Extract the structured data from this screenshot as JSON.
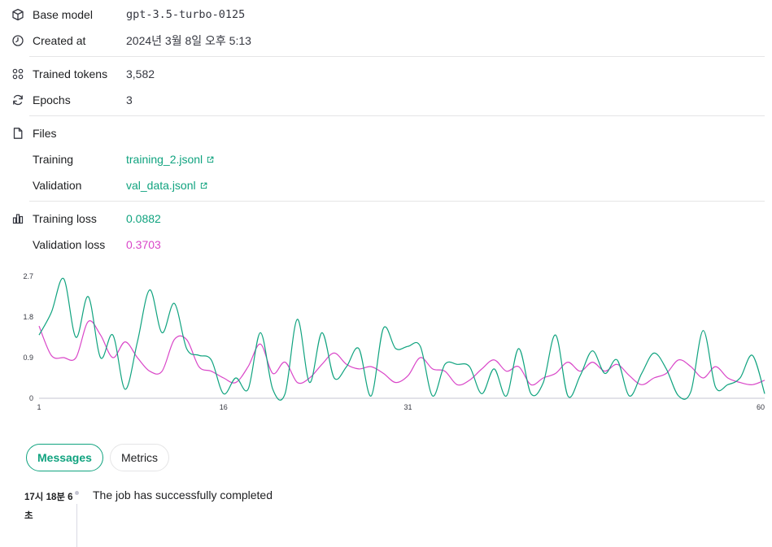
{
  "details": {
    "base_model": {
      "label": "Base model",
      "value": "gpt-3.5-turbo-0125",
      "icon": "cube-icon"
    },
    "created_at": {
      "label": "Created at",
      "value": "2024년 3월 8일 오후 5:13",
      "icon": "clock-icon"
    },
    "trained_tokens": {
      "label": "Trained tokens",
      "value": "3,582",
      "icon": "grid-icon"
    },
    "epochs": {
      "label": "Epochs",
      "value": "3",
      "icon": "refresh-icon"
    },
    "files": {
      "label": "Files",
      "icon": "file-icon",
      "training": {
        "label": "Training",
        "value": "training_2.jsonl"
      },
      "validation": {
        "label": "Validation",
        "value": "val_data.jsonl"
      }
    },
    "training_loss": {
      "label": "Training loss",
      "value": "0.0882",
      "icon": "bar-chart-icon"
    },
    "validation_loss": {
      "label": "Validation loss",
      "value": "0.3703"
    }
  },
  "colors": {
    "accent": "#10a37f",
    "validation": "#d946c8",
    "divider": "#e5e5e6"
  },
  "chart_data": {
    "type": "line",
    "x_ticks": [
      "1",
      "16",
      "31",
      "60"
    ],
    "y_ticks": [
      "0",
      "0.9",
      "1.8",
      "2.7"
    ],
    "ylim": [
      0,
      2.7
    ],
    "xlim": [
      1,
      60
    ],
    "grid": false,
    "series": [
      {
        "color": "#10a37f",
        "values": [
          1.4,
          1.9,
          2.65,
          1.35,
          2.25,
          0.9,
          1.4,
          0.2,
          1.25,
          2.4,
          1.45,
          2.1,
          1.1,
          0.95,
          0.85,
          0.1,
          0.45,
          0.2,
          1.45,
          0.2,
          0.1,
          1.75,
          0.35,
          1.45,
          0.45,
          0.7,
          1.1,
          0.05,
          1.55,
          1.1,
          1.15,
          1.15,
          0.05,
          0.75,
          0.75,
          0.7,
          0.1,
          0.65,
          0.05,
          1.1,
          0.1,
          0.35,
          1.4,
          0.05,
          0.5,
          1.05,
          0.55,
          0.85,
          0.05,
          0.55,
          1.0,
          0.65,
          0.05,
          0.15,
          1.5,
          0.25,
          0.3,
          0.45,
          0.95,
          0.1
        ]
      },
      {
        "color": "#d946c8",
        "values": [
          1.6,
          0.95,
          0.9,
          0.9,
          1.7,
          1.4,
          0.9,
          1.25,
          0.9,
          0.6,
          0.6,
          1.3,
          1.3,
          0.7,
          0.6,
          0.45,
          0.35,
          0.7,
          1.2,
          0.55,
          0.8,
          0.35,
          0.45,
          0.75,
          1.0,
          0.75,
          0.65,
          0.7,
          0.55,
          0.35,
          0.5,
          0.9,
          0.65,
          0.6,
          0.3,
          0.4,
          0.65,
          0.85,
          0.6,
          0.7,
          0.3,
          0.45,
          0.55,
          0.8,
          0.6,
          0.8,
          0.6,
          0.75,
          0.5,
          0.3,
          0.45,
          0.55,
          0.85,
          0.7,
          0.45,
          0.7,
          0.45,
          0.35,
          0.3,
          0.4
        ]
      }
    ]
  },
  "tabs": [
    {
      "label": "Messages",
      "active": true
    },
    {
      "label": "Metrics",
      "active": false
    }
  ],
  "messages": [
    {
      "time": "17시 18분 6초",
      "text": "The job has successfully completed"
    }
  ]
}
